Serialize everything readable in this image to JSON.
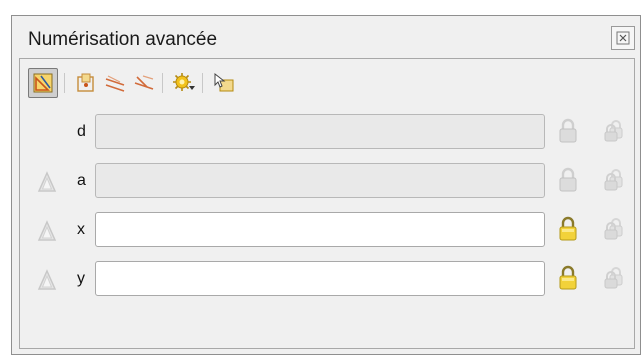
{
  "window": {
    "title": "Numérisation avancée"
  },
  "toolbar": {
    "icons": [
      "cad-toggle-icon",
      "construction-mode-icon",
      "parallel-icon",
      "perpendicular-icon",
      "settings-icon",
      "snap-cursor-icon"
    ]
  },
  "fields": [
    {
      "label": "d",
      "value": "",
      "enabled": false,
      "locked": false
    },
    {
      "label": "a",
      "value": "",
      "enabled": false,
      "locked": false
    },
    {
      "label": "x",
      "value": "",
      "enabled": true,
      "locked": true
    },
    {
      "label": "y",
      "value": "",
      "enabled": true,
      "locked": true
    }
  ],
  "colors": {
    "lock_active": "#f2d23a",
    "lock_inactive": "#c9c9c9",
    "panel_bg": "#f0f0f0"
  }
}
